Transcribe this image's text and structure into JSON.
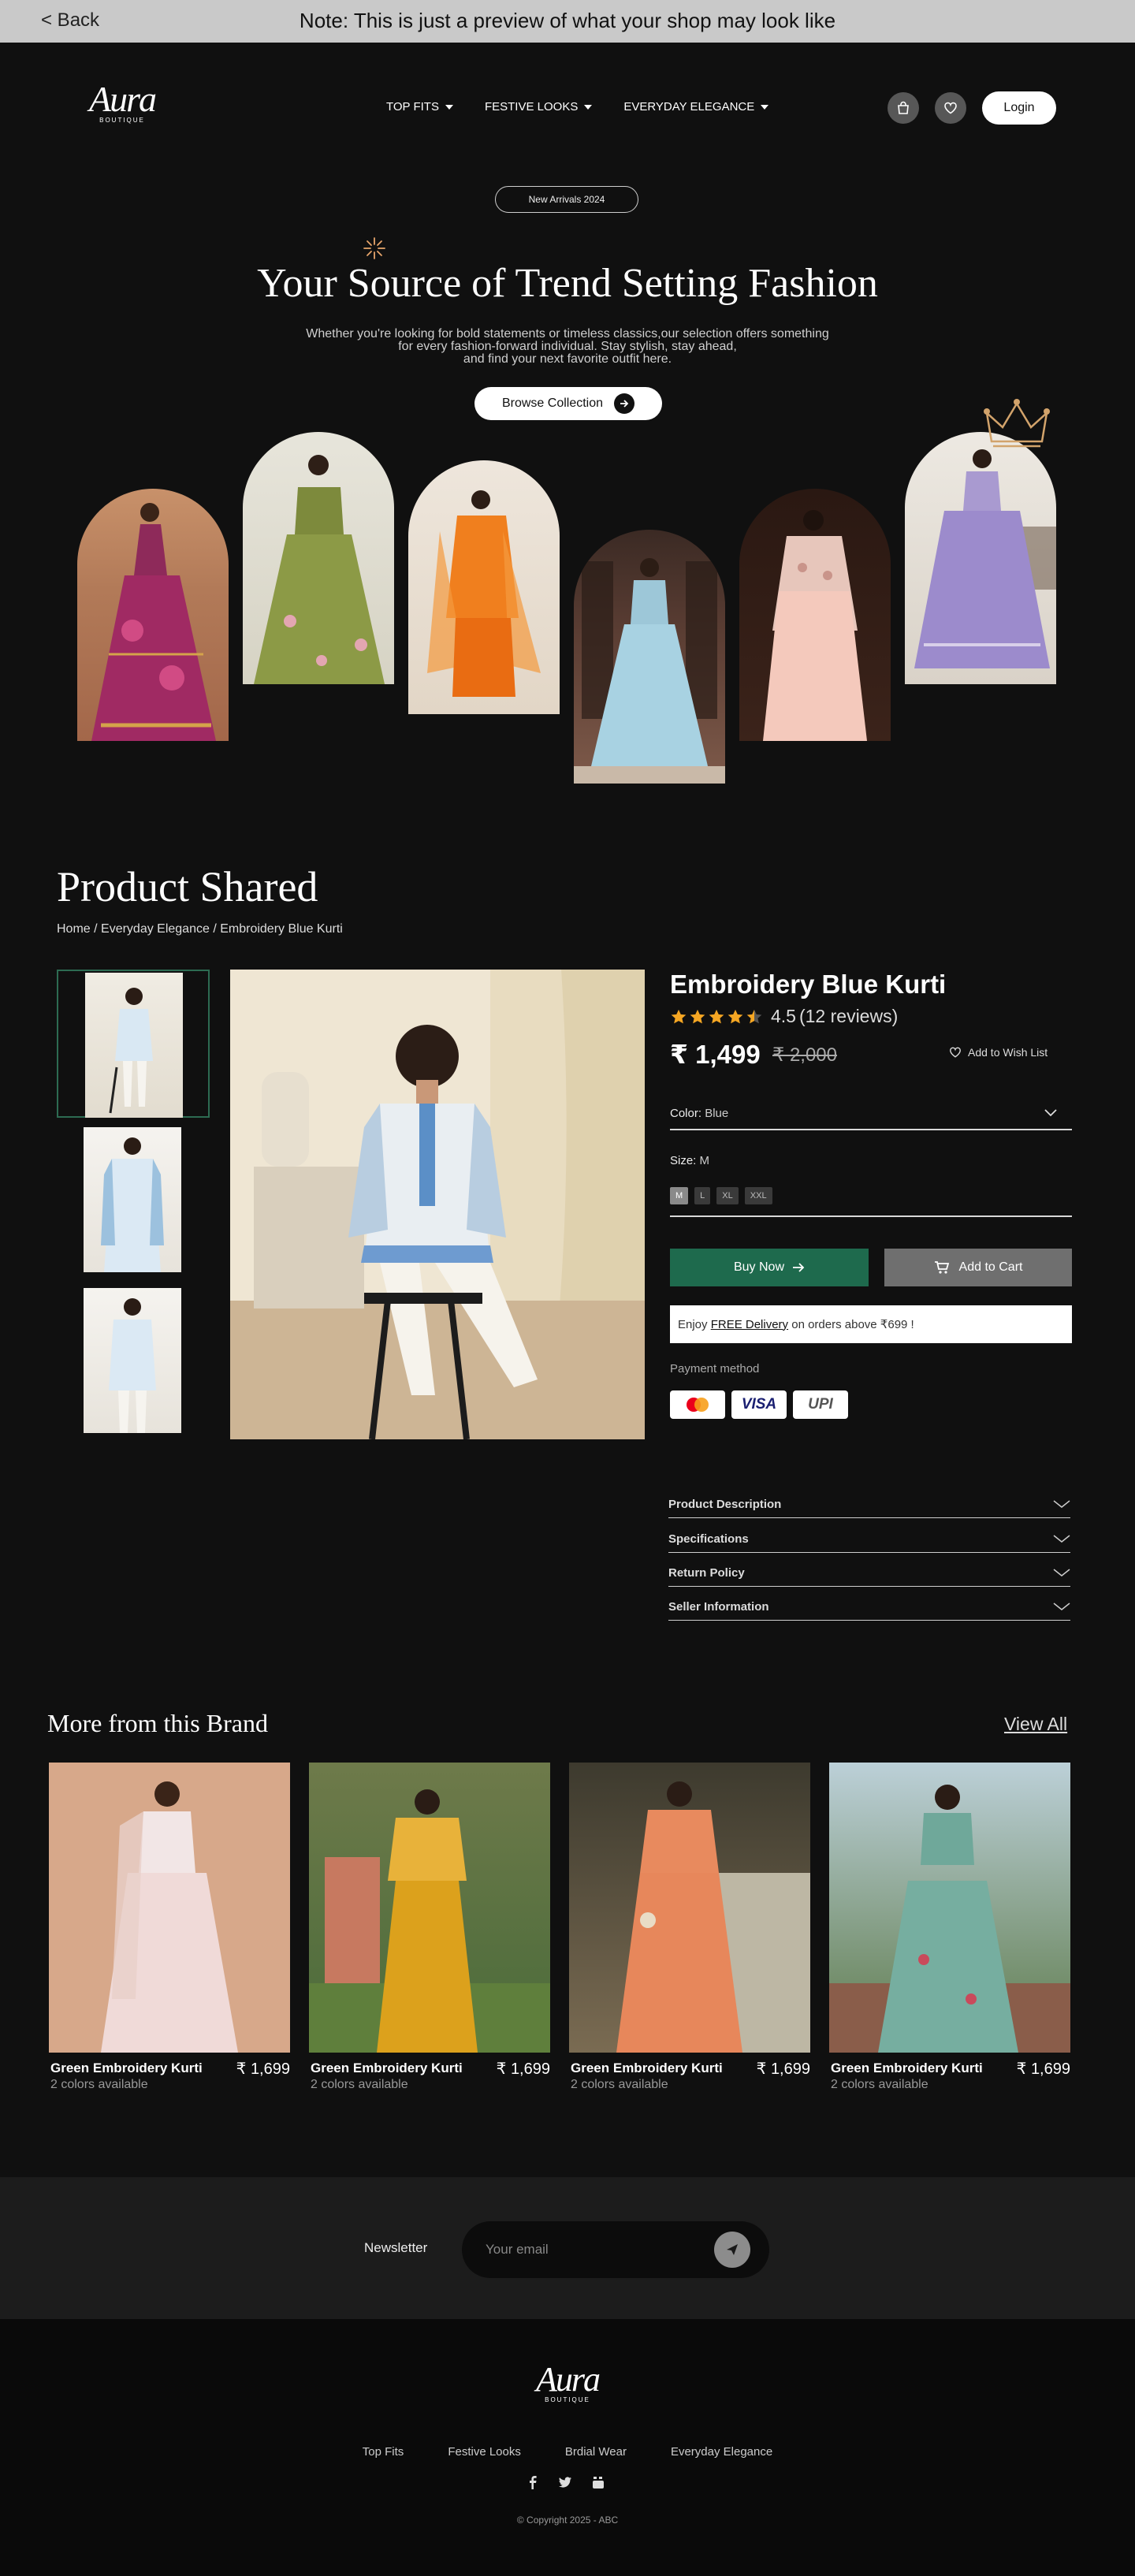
{
  "preview_bar": {
    "back_label": "< Back",
    "note": "Note: This is just a preview of what your shop may look like"
  },
  "brand": {
    "logo_text": "Aura",
    "logo_sub": "BOUTIQUE"
  },
  "nav": {
    "items": [
      {
        "label": "TOP FITS"
      },
      {
        "label": "FESTIVE LOOKS"
      },
      {
        "label": "EVERYDAY ELEGANCE"
      }
    ],
    "login_label": "Login"
  },
  "hero": {
    "badge": "New Arrivals 2024",
    "title": "Your Source of Trend Setting Fashion",
    "subtitle_lines": [
      "Whether you're looking for bold statements or timeless classics,our selection offers something",
      "for every fashion-forward individual. Stay stylish, stay ahead,",
      "and find your next favorite outfit here."
    ],
    "cta_label": "Browse Collection"
  },
  "product_section": {
    "title": "Product Shared",
    "breadcrumb": "Home / Everyday Elegance / Embroidery Blue Kurti",
    "product": {
      "name": "Embroidery Blue Kurti",
      "rating": 4.5,
      "rating_text": "4.5",
      "reviews_text": "(12 reviews)",
      "price": "₹ 1,499",
      "old_price": "₹ 2,000",
      "wishlist_label": "Add to Wish List",
      "color_label": "Color:",
      "color_value": "Blue",
      "size_label": "Size:",
      "size_value": "M",
      "sizes": [
        "M",
        "L",
        "XL",
        "XXL"
      ],
      "buy_label": "Buy Now",
      "cart_label": "Add to Cart",
      "delivery_pre": "Enjoy",
      "delivery_link": "FREE Delivery",
      "delivery_post": "on orders above ₹699 !",
      "payment_label": "Payment method",
      "payment_methods": [
        "mastercard",
        "VISA",
        "UPI"
      ]
    },
    "accordions": [
      "Product Description",
      "Specifications",
      "Return Policy",
      "Seller Information"
    ]
  },
  "more_brand": {
    "title": "More from this Brand",
    "view_all": "View All",
    "products": [
      {
        "name": "Green Embroidery Kurti",
        "price": "₹ 1,699",
        "colors": "2 colors available"
      },
      {
        "name": "Green Embroidery Kurti",
        "price": "₹ 1,699",
        "colors": "2 colors available"
      },
      {
        "name": "Green Embroidery Kurti",
        "price": "₹ 1,699",
        "colors": "2 colors available"
      },
      {
        "name": "Green Embroidery Kurti",
        "price": "₹ 1,699",
        "colors": "2 colors available"
      }
    ]
  },
  "newsletter": {
    "label": "Newsletter",
    "placeholder": "Your email"
  },
  "footer": {
    "links": [
      "Top Fits",
      "Festive Looks",
      "Brdial Wear",
      "Everyday Elegance"
    ],
    "copyright": "© Copyright 2025 - ABC"
  },
  "colors": {
    "accent_green": "#1e6a4d",
    "star": "#f5a623",
    "background": "#101010"
  }
}
